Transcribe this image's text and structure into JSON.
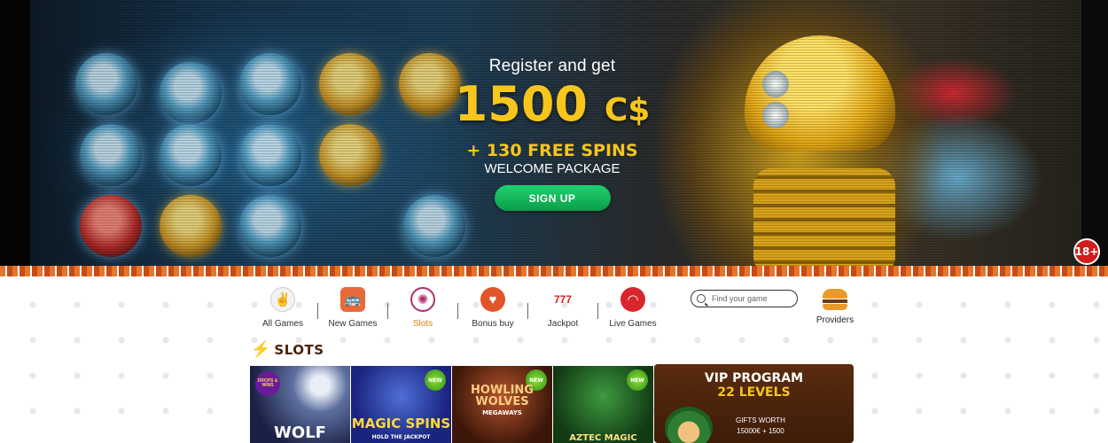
{
  "hero": {
    "pre_title": "Register and get",
    "amount": "1500",
    "currency": "C$",
    "spins": "+ 130 FREE SPINS",
    "package": "WELCOME PACKAGE",
    "signup_label": "SIGN UP",
    "age_badge": "18+"
  },
  "nav": {
    "items": [
      {
        "label": "All Games",
        "icon": "dice-icon",
        "active": false
      },
      {
        "label": "New Games",
        "icon": "bus-icon",
        "active": false
      },
      {
        "label": "Slots",
        "icon": "wheel-icon",
        "active": true
      },
      {
        "label": "Bonus buy",
        "icon": "heart-icon",
        "active": false
      },
      {
        "label": "Jackpot",
        "icon": "777-icon",
        "active": false
      },
      {
        "label": "Live Games",
        "icon": "lips-icon",
        "active": false
      }
    ],
    "search_placeholder": "Find your game",
    "providers_label": "Providers"
  },
  "section": {
    "title": "SLOTS"
  },
  "tiles": [
    {
      "name": "WOLF",
      "badge": "DROPS & WINS"
    },
    {
      "name": "MAGIC SPINS",
      "sub": "HOLD THE JACKPOT",
      "badge": "NEW"
    },
    {
      "name": "HOWLING WOLVES",
      "sub": "MEGAWAYS",
      "badge": "NEW"
    },
    {
      "name": "AZTEC MAGIC",
      "badge": "NEW"
    }
  ],
  "vip": {
    "title": "VIP PROGRAM",
    "levels": "22 LEVELS",
    "gift_line1": "GIFTS WORTH",
    "gift_line2": "15000€ + 1500"
  },
  "colors": {
    "accent_gold": "#f7c51c",
    "signup_green": "#12b85b",
    "active_nav": "#e07a10",
    "section_title": "#4a2206"
  }
}
